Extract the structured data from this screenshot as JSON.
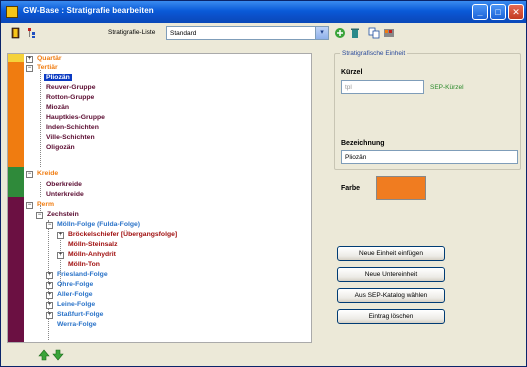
{
  "window": {
    "title": "GW-Base : Stratigrafie bearbeiten"
  },
  "toolbar": {
    "list_label": "Stratigrafie-Liste",
    "list_value": "Standard",
    "icons": [
      "exit-door-icon",
      "tree-options-icon",
      "add-green-icon",
      "delete-icon",
      "copy-icon",
      "palette-icon"
    ]
  },
  "colors": {
    "quartaer": "#f5d23a",
    "tertiaer": "#f07c10",
    "kreide": "#2f8a3a",
    "perm": "#6b1042",
    "selection": "#0a3ac2",
    "farbe": "#f07c20"
  },
  "tree": {
    "quartaer": "Quartär",
    "tertiaer": "Tertiär",
    "pliozaen": "Pliozän",
    "reuver": "Reuver-Gruppe",
    "rotton": "Rotton-Gruppe",
    "miozaen": "Miozän",
    "hauptkies": "Hauptkies-Gruppe",
    "inden": "Inden-Schichten",
    "ville": "Ville-Schichten",
    "oligozaen": "Oligozän",
    "kreide": "Kreide",
    "oberkreide": "Oberkreide",
    "unterkreide": "Unterkreide",
    "perm": "Perm",
    "zechstein": "Zechstein",
    "moelln_folge": "Mölln-Folge (Fulda-Folge)",
    "brueckelschiefer": "Bröckelschiefer [Übergangsfolge]",
    "moelln_steinsalz": "Mölln-Steinsalz",
    "moelln_anhydrit": "Mölln-Anhydrit",
    "moelln_ton": "Mölln-Ton",
    "friesland": "Friesland-Folge",
    "ohre": "Ohre-Folge",
    "aller": "Aller-Folge",
    "leine": "Leine-Folge",
    "stassfurt": "Staßfurt-Folge",
    "werra": "Werra-Folge"
  },
  "detail": {
    "group_title": "Stratigrafische Einheit",
    "kuerzel_label": "Kürzel",
    "kuerzel_value": "tpl",
    "sep_kuerzel": "SEP-Kürzel",
    "bezeichnung_label": "Bezeichnung",
    "bezeichnung_value": "Pliozän",
    "farbe_label": "Farbe"
  },
  "buttons": {
    "neue_einheit": "Neue Einheit einfügen",
    "neue_untereinheit": "Neue Untereinheit",
    "aus_sep": "Aus SEP-Katalog wählen",
    "eintrag_loeschen": "Eintrag löschen"
  },
  "bottom": {
    "icons": [
      "move-up-icon",
      "move-down-icon"
    ]
  }
}
